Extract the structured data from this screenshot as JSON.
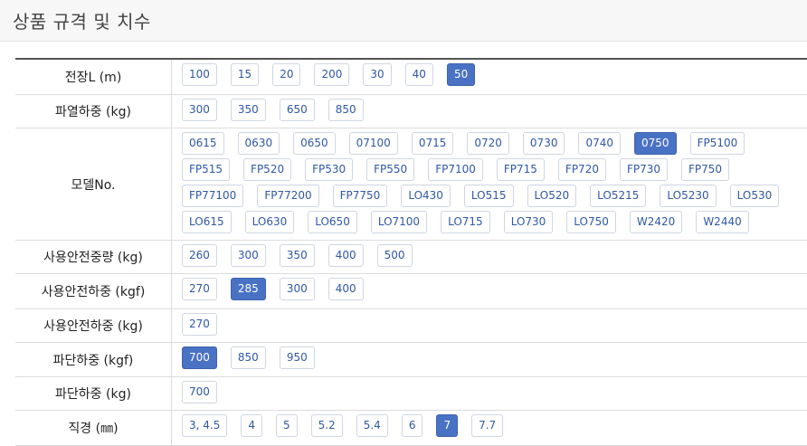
{
  "header": {
    "title": "상품 규격 및 치수"
  },
  "rows": [
    {
      "label": "전장L (m)",
      "options": [
        "100",
        "15",
        "20",
        "200",
        "30",
        "40",
        "50"
      ],
      "selected": "50"
    },
    {
      "label": "파열하중 (kg)",
      "options": [
        "300",
        "350",
        "650",
        "850"
      ],
      "selected": null
    },
    {
      "label": "모델No.",
      "options": [
        "0615",
        "0630",
        "0650",
        "07100",
        "0715",
        "0720",
        "0730",
        "0740",
        "0750",
        "FP5100",
        "FP515",
        "FP520",
        "FP530",
        "FP550",
        "FP7100",
        "FP715",
        "FP720",
        "FP730",
        "FP750",
        "FP77100",
        "FP77200",
        "FP7750",
        "LO430",
        "LO515",
        "LO520",
        "LO5215",
        "LO5230",
        "LO530",
        "LO615",
        "LO630",
        "LO650",
        "LO7100",
        "LO715",
        "LO730",
        "LO750",
        "W2420",
        "W2440"
      ],
      "selected": "0750"
    },
    {
      "label": "사용안전중량 (kg)",
      "options": [
        "260",
        "300",
        "350",
        "400",
        "500"
      ],
      "selected": null
    },
    {
      "label": "사용안전하중 (kgf)",
      "options": [
        "270",
        "285",
        "300",
        "400"
      ],
      "selected": "285"
    },
    {
      "label": "사용안전하중 (kg)",
      "options": [
        "270"
      ],
      "selected": null
    },
    {
      "label": "파단하중 (kgf)",
      "options": [
        "700",
        "850",
        "950"
      ],
      "selected": "700"
    },
    {
      "label": "파단하중 (kg)",
      "options": [
        "700"
      ],
      "selected": null
    },
    {
      "label": "직경 (㎜)",
      "options": [
        "3, 4.5",
        "4",
        "5",
        "5.2",
        "5.4",
        "6",
        "7",
        "7.7"
      ],
      "selected": "7"
    }
  ],
  "colors": {
    "accent": "#4a72c4",
    "option_text": "#2f58a8",
    "option_border": "#cfd6e2"
  }
}
